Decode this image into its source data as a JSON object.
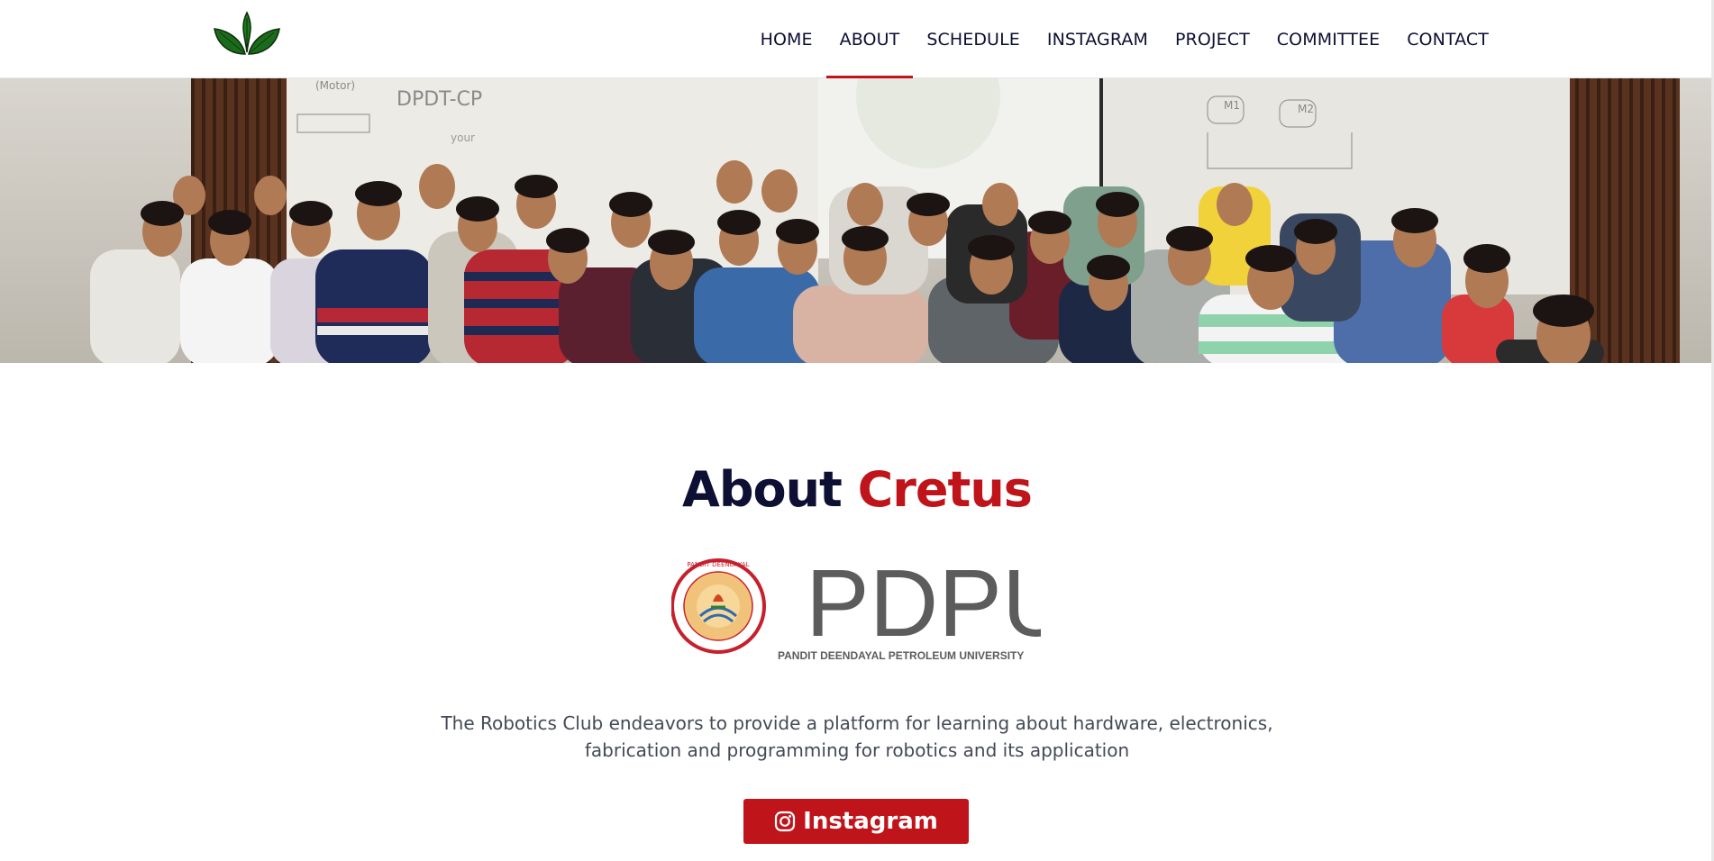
{
  "nav": {
    "items": [
      {
        "label": "HOME"
      },
      {
        "label": "ABOUT",
        "active": true
      },
      {
        "label": "SCHEDULE"
      },
      {
        "label": "INSTAGRAM"
      },
      {
        "label": "PROJECT"
      },
      {
        "label": "COMMITTEE"
      },
      {
        "label": "CONTACT"
      }
    ],
    "logo_icon": "leaf-sprout-icon"
  },
  "hero": {
    "description_icon": "group-photo",
    "board_texts": [
      "(Motor)",
      "DPDT-CP",
      "M1",
      "M2",
      "your"
    ]
  },
  "about": {
    "title_part1": "About",
    "title_part2": "Cretus",
    "logo": {
      "wordmark": "PDPU",
      "subtitle": "PANDIT DEENDAYAL PETROLEUM UNIVERSITY",
      "seal_text": "PANDIT DEENDAYAL PETROLEUM UNIVERSITY"
    },
    "description_line1": "The Robotics Club endeavors to provide a platform for learning about hardware, electronics,",
    "description_line2": "fabrication and programming for robotics and its application",
    "button_label": "Instagram",
    "button_icon": "instagram-icon"
  },
  "colors": {
    "accent": "#c0141b",
    "navy": "#0d0f33",
    "text": "#444a55"
  }
}
